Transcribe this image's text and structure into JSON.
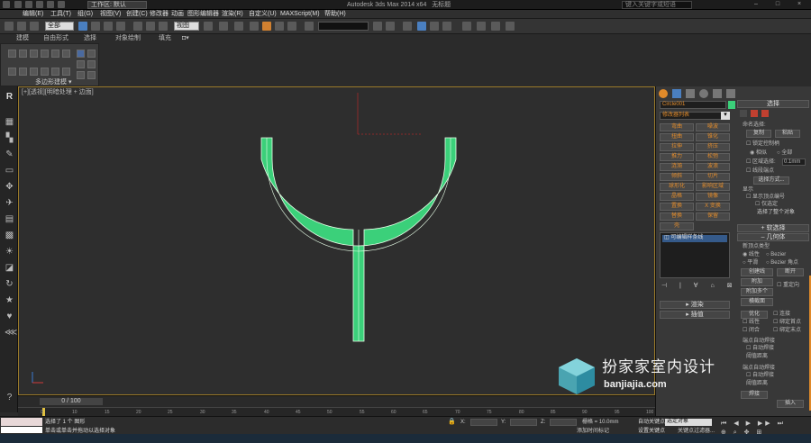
{
  "titlebar": {
    "workspace_label": "工作区: 默认",
    "app_title": "Autodesk 3ds Max 2014 x64",
    "file_name": "无标题",
    "search_placeholder": "键入关键字或短语"
  },
  "menu": [
    "编辑(E)",
    "工具(T)",
    "组(G)",
    "视图(V)",
    "创建(C)",
    "修改器",
    "动画",
    "图形编辑器",
    "渲染(R)",
    "自定义(U)",
    "MAXScript(M)",
    "帮助(H)"
  ],
  "toolbar": {
    "selection_filter": "全部",
    "coord_system": "视图"
  },
  "ribbon": {
    "tabs": [
      "建模",
      "自由形式",
      "选择",
      "对象绘制",
      "填充"
    ],
    "panel_label": "多边形建模"
  },
  "viewport": {
    "label": "[+][透视][明暗处理 + 边面]"
  },
  "command_panel": {
    "object_name": "Circle001",
    "modifier_list": "修改器列表",
    "modifier_buttons": [
      [
        "弯曲",
        "噪波"
      ],
      [
        "扭曲",
        "锥化"
      ],
      [
        "拉伸",
        "挤压"
      ],
      [
        "推力",
        "松弛"
      ],
      [
        "涟漪",
        "波浪"
      ],
      [
        "倾斜",
        "切片"
      ],
      [
        "球形化",
        "影响区域"
      ],
      [
        "晶格",
        "镜像"
      ],
      [
        "置换",
        "X 变换"
      ],
      [
        "替换",
        "保留"
      ],
      [
        "壳",
        ""
      ]
    ],
    "stack_item": "可编辑样条线",
    "render_rollout": "渲染",
    "interp_rollout": "插值",
    "right_column": {
      "selection_title": "选择",
      "named_sel": "命名选择:",
      "copy": "复制",
      "paste": "粘贴",
      "lock_handles": "锁定控制柄",
      "similar": "相似",
      "all": "全部",
      "area_select": "区域选择:",
      "area_value": "0.1mm",
      "segment_end": "线段端点",
      "select_by": "选择方式...",
      "display": "显示",
      "show_vertex_numbers": "显示顶点编号",
      "selected_only": "仅选定",
      "selected_whole": "选择了整个对象",
      "soft_selection": "软选择",
      "geometry": "几何体",
      "new_vertex_type": "新顶点类型",
      "linear": "线性",
      "bezier": "Bezier",
      "smooth": "平滑",
      "bezier_corner": "Bezier 角点",
      "create_line": "创建线",
      "break": "断开",
      "attach": "附加",
      "reorient": "重定向",
      "attach_multiple": "附加多个",
      "cross_section": "横截面",
      "optimize": "优化",
      "connect": "连接",
      "linear2": "线性",
      "bind_first": "绑定首点",
      "closed": "闭合",
      "bind_last": "绑定末点",
      "end_point_auto_weld": "端点自动焊接",
      "auto_weld": "自动焊接",
      "threshold": "阈值距离",
      "weld": "焊接",
      "insert": "插入"
    }
  },
  "timeline": {
    "frame_counter": "0 / 100",
    "ticks": [
      "0",
      "10",
      "15",
      "20",
      "25",
      "30",
      "35",
      "40",
      "45",
      "50",
      "55",
      "60",
      "65",
      "70",
      "75",
      "80",
      "85",
      "90",
      "95",
      "100"
    ]
  },
  "status": {
    "selected": "选择了 1 个 图形",
    "prompt": "单击或单击并拖动以选择对象",
    "grid": "栅格 = 10.0mm",
    "add_time_tag": "添加时间标记",
    "auto_key": "自动关键点",
    "set_key": "设置关键点",
    "selected_object": "选定对象",
    "key_filter": "关键点过滤器..."
  },
  "watermark": {
    "title": "扮家家室内设计",
    "url": "banjiajia.com"
  },
  "colors": {
    "shape": "#3bd07a",
    "accent": "#e08a2a",
    "highlight": "#4a7fc0"
  }
}
